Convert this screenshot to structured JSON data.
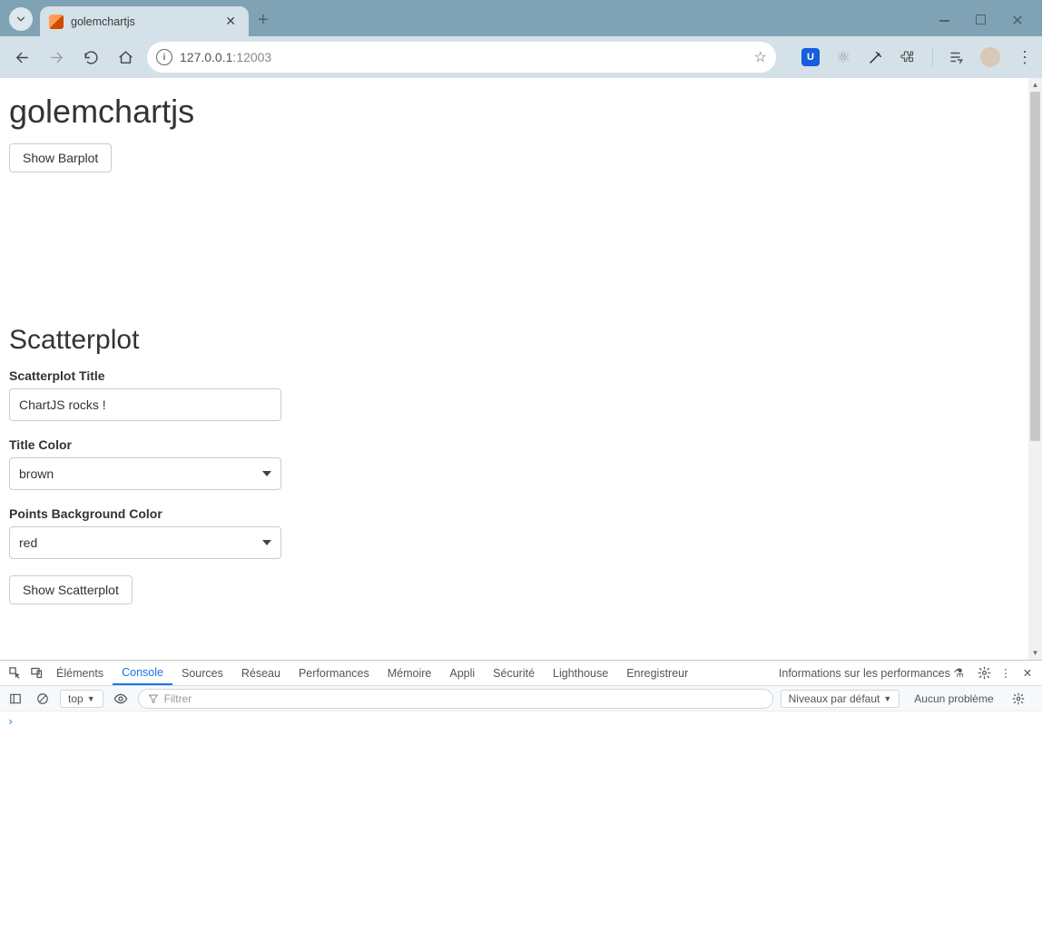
{
  "browser": {
    "tab_title": "golemchartjs",
    "url_host": "127.0.0.1",
    "url_port": ":12003"
  },
  "page": {
    "title": "golemchartjs",
    "show_barplot_btn": "Show Barplot",
    "section_title": "Scatterplot",
    "label_title": "Scatterplot Title",
    "input_title_value": "ChartJS rocks !",
    "label_title_color": "Title Color",
    "select_title_color_value": "brown",
    "label_points_bg": "Points Background Color",
    "select_points_bg_value": "red",
    "show_scatter_btn": "Show Scatterplot"
  },
  "devtools": {
    "tabs": [
      "Éléments",
      "Console",
      "Sources",
      "Réseau",
      "Performances",
      "Mémoire",
      "Appli",
      "Sécurité",
      "Lighthouse",
      "Enregistreur",
      "Informations sur les performances"
    ],
    "active_tab": "Console",
    "context": "top",
    "filter_placeholder": "Filtrer",
    "levels": "Niveaux par défaut",
    "issues": "Aucun problème"
  }
}
